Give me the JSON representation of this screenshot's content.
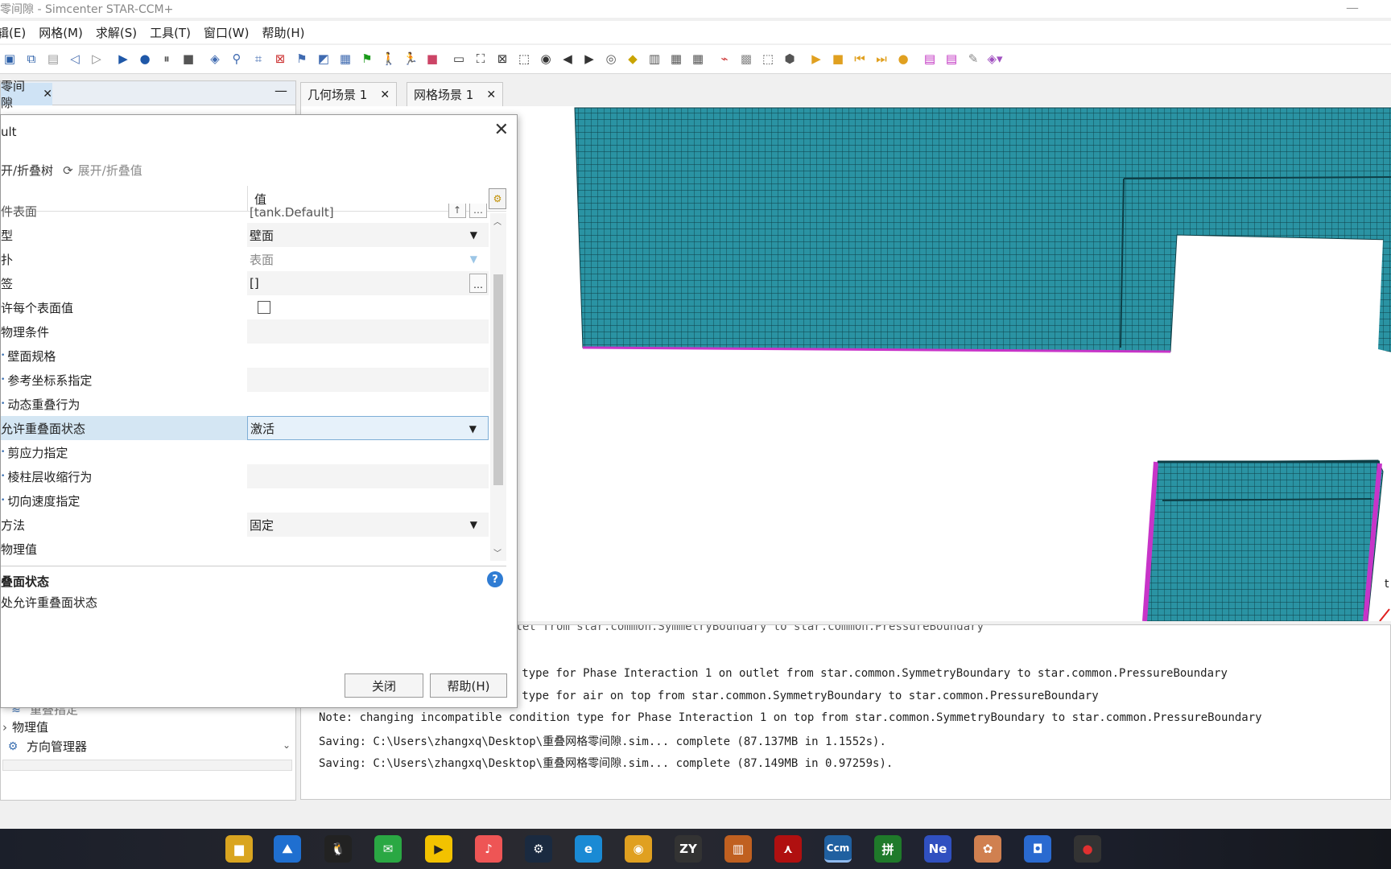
{
  "window": {
    "title": "零间隙 - Simcenter STAR-CCM+"
  },
  "menu": [
    "辑(E)",
    "网格(M)",
    "求解(S)",
    "工具(T)",
    "窗口(W)",
    "帮助(H)"
  ],
  "toolbar_icons": [
    "save-sim-icon",
    "copy-icon",
    "file-icon",
    "back-icon",
    "forward-icon",
    "run-icon",
    "record-icon",
    "pause-icon",
    "stop-icon",
    "mesh-icon",
    "filter-icon",
    "region-icon",
    "delete-boundary-icon",
    "split-icon",
    "surface-icon",
    "grid-icon",
    "flag-icon",
    "walk-icon",
    "run-man-icon",
    "stop-red-icon",
    "scene-icon",
    "fit-icon",
    "zoom-box-icon",
    "select-icon",
    "camera-icon",
    "arrow-left-icon",
    "arrow-right-icon",
    "rotate-icon",
    "plane-icon",
    "ruler-icon",
    "table-icon",
    "table2-icon",
    "plot-icon",
    "mesh2-icon",
    "pick-icon",
    "pick2-icon",
    "play-icon",
    "stop2-icon",
    "step-back-icon",
    "step-fwd-icon",
    "record2-icon",
    "layout-icon",
    "layout2-icon",
    "pin-icon",
    "cube-icon"
  ],
  "left_pane": {
    "tab_label": "零间隙",
    "tree": [
      {
        "label": "重叠指定",
        "icon": "wave-icon"
      },
      {
        "label": "物理值",
        "icon": "none"
      },
      {
        "label": "方向管理器",
        "icon": "axis-icon"
      }
    ]
  },
  "scene_tabs": [
    "几何场景 1",
    "网格场景 1"
  ],
  "output_lines": [
    "condition type for air on outlet from star.common.SymmetryBoundary to star.common.PressureBoundary",
    "condition type for Phase Interaction 1 on outlet from star.common.SymmetryBoundary to star.common.PressureBoundary",
    "condition type for air on top from star.common.SymmetryBoundary to star.common.PressureBoundary",
    "Note: changing incompatible condition type for Phase Interaction 1 on top from star.common.SymmetryBoundary to star.common.PressureBoundary",
    "Saving: C:\\Users\\zhangxq\\Desktop\\重叠网格零间隙.sim... complete (87.137MB in 1.1552s).",
    "Saving: C:\\Users\\zhangxq\\Desktop\\重叠网格零间隙.sim... complete (87.149MB in 0.97259s)."
  ],
  "viewport_label": "t",
  "dialog": {
    "title": "ult",
    "toolbar": {
      "expand_tree": "开/折叠树",
      "expand_values": "展开/折叠值"
    },
    "value_header": "值",
    "rows": [
      {
        "name": "件表面",
        "value": "[tank.Default]",
        "kind": "ellipsis"
      },
      {
        "name": "型",
        "value": "壁面",
        "kind": "dropdown"
      },
      {
        "name": "扑",
        "value": "表面",
        "kind": "dropdown-muted"
      },
      {
        "name": "签",
        "value": "[]",
        "kind": "ellipsis"
      },
      {
        "name": "许每个表面值",
        "value": "",
        "kind": "checkbox"
      },
      {
        "name": "物理条件",
        "value": "",
        "kind": "empty"
      },
      {
        "name": "壁面规格",
        "value": "",
        "kind": "empty"
      },
      {
        "name": "参考坐标系指定",
        "value": "",
        "kind": "empty"
      },
      {
        "name": "动态重叠行为",
        "value": "",
        "kind": "empty"
      },
      {
        "name": "允许重叠面状态",
        "value": "激活",
        "kind": "dropdown-selected"
      },
      {
        "name": "剪应力指定",
        "value": "",
        "kind": "empty"
      },
      {
        "name": "棱柱层收缩行为",
        "value": "",
        "kind": "empty"
      },
      {
        "name": "切向速度指定",
        "value": "",
        "kind": "empty"
      },
      {
        "name": "方法",
        "value": "固定",
        "kind": "dropdown"
      },
      {
        "name": "物理值",
        "value": "",
        "kind": "empty"
      }
    ],
    "description": {
      "title": "叠面状态",
      "text": "处允许重叠面状态"
    },
    "buttons": {
      "close": "关闭",
      "help": "帮助(H)"
    }
  },
  "taskbar_apps": [
    "file-explorer-icon",
    "photos-icon",
    "qq-icon",
    "wechat-icon",
    "potplayer-icon",
    "lalal-icon",
    "steam-icon",
    "edge-icon",
    "chrome-icon",
    "zy-icon",
    "city-icon",
    "acrobat-icon",
    "starccm-icon",
    "chinese-input-icon",
    "ne-icon",
    "paint-icon",
    "mail-icon",
    "record-icon"
  ],
  "taskbar_labels": {
    "zy": "ZY",
    "ccm": "Ccm",
    "ne": "Ne"
  },
  "colors": {
    "mesh": "#2a93a3",
    "mesh_line": "#0d3e46",
    "boundary": "#c734c8",
    "selected_row": "#d4e6f3"
  }
}
